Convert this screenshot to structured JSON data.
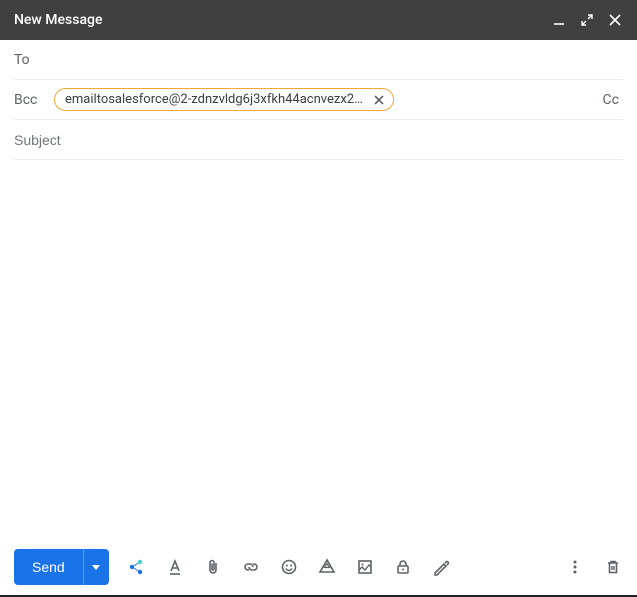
{
  "header": {
    "title": "New Message"
  },
  "fields": {
    "to_label": "To",
    "bcc_label": "Bcc",
    "cc_label": "Cc",
    "subject_placeholder": "Subject",
    "subject_value": "",
    "bcc_chip": "emailtosalesforce@2-zdnzvldg6j3xfkh44acnvezx2qhdx..."
  },
  "footer": {
    "send_label": "Send"
  },
  "colors": {
    "header_bg": "#404040",
    "primary": "#1a73e8",
    "chip_border": "#f0a839"
  }
}
